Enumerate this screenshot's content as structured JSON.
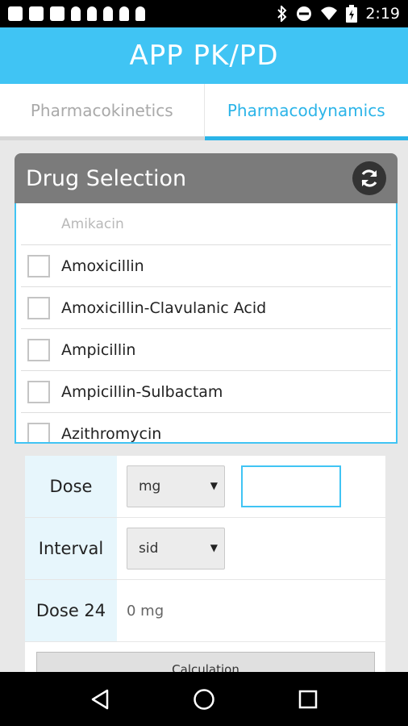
{
  "status_bar": {
    "time": "2:19",
    "left_icons": [
      "message-icon",
      "facebook-icon",
      "facebook-icon",
      "person-icon",
      "person-icon",
      "person-icon",
      "person-icon",
      "person-icon"
    ],
    "right_icons": [
      "bluetooth-icon",
      "dnd-icon",
      "wifi-icon",
      "battery-icon"
    ]
  },
  "app_bar": {
    "title": "APP PK/PD"
  },
  "tabs": [
    {
      "label": "Pharmacokinetics",
      "active": false
    },
    {
      "label": "Pharmacodynamics",
      "active": true
    }
  ],
  "drug_selection": {
    "title": "Drug Selection",
    "refresh_icon": "refresh-icon",
    "items": [
      {
        "label": "Amikacin",
        "disabled": true
      },
      {
        "label": "Amoxicillin",
        "checked": false
      },
      {
        "label": "Amoxicillin-Clavulanic Acid",
        "checked": false
      },
      {
        "label": "Ampicillin",
        "checked": false
      },
      {
        "label": "Ampicillin-Sulbactam",
        "checked": false
      },
      {
        "label": "Azithromycin",
        "checked": false
      }
    ]
  },
  "form": {
    "dose_label": "Dose",
    "dose_unit": "mg",
    "dose_value": "",
    "interval_label": "Interval",
    "interval_value": "sid",
    "dose24_label": "Dose 24",
    "dose24_value": "0 mg",
    "calc_label": "Calculation"
  },
  "colors": {
    "accent": "#40c4f4",
    "tab_active": "#2bb4e8",
    "card_header": "#7b7b7b"
  }
}
